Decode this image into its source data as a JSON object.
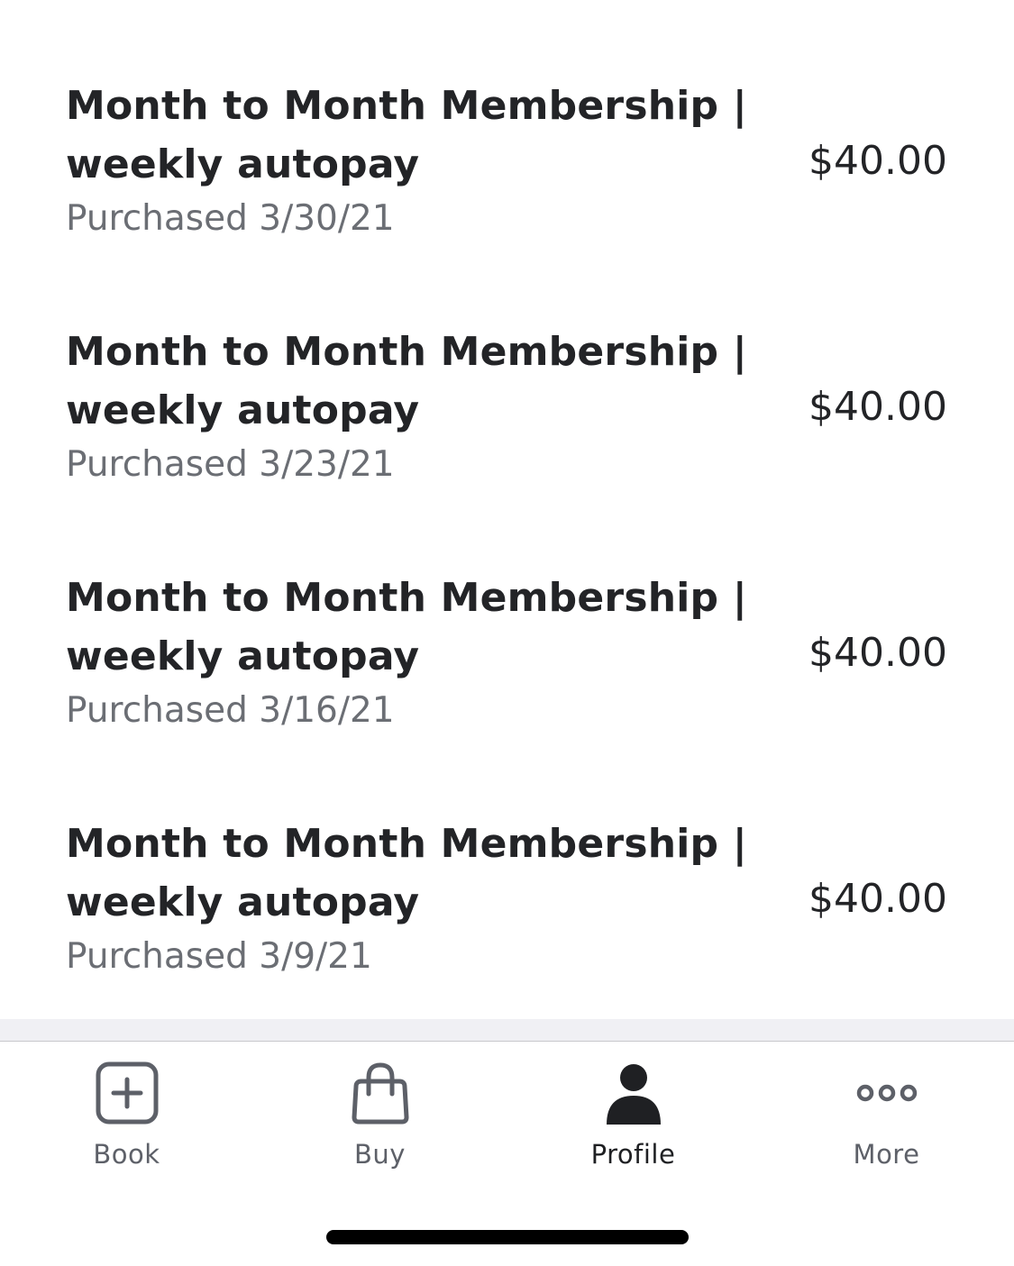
{
  "purchases": [
    {
      "title_line1": "Month to Month Membership |",
      "title_line2": "weekly autopay",
      "date": "Purchased 3/30/21",
      "price": "$40.00"
    },
    {
      "title_line1": "Month to Month Membership |",
      "title_line2": "weekly autopay",
      "date": "Purchased 3/23/21",
      "price": "$40.00"
    },
    {
      "title_line1": "Month to Month Membership |",
      "title_line2": "weekly autopay",
      "date": "Purchased 3/16/21",
      "price": "$40.00"
    },
    {
      "title_line1": "Month to Month Membership |",
      "title_line2": "weekly autopay",
      "date": "Purchased 3/9/21",
      "price": "$40.00"
    }
  ],
  "tab_bar": {
    "tabs": [
      {
        "label": "Book",
        "icon": "plus-square-icon",
        "active": false
      },
      {
        "label": "Buy",
        "icon": "shopping-bag-icon",
        "active": false
      },
      {
        "label": "Profile",
        "icon": "person-icon",
        "active": true
      },
      {
        "label": "More",
        "icon": "ellipsis-icon",
        "active": false
      }
    ]
  },
  "colors": {
    "text_primary": "#232427",
    "text_secondary": "#6b6e74",
    "tab_inactive": "#5d6068",
    "tab_active": "#1f2023",
    "divider_band": "#f0f0f4"
  }
}
